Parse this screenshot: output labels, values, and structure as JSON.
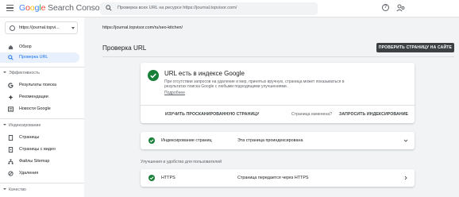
{
  "app": {
    "logo_google": [
      "G",
      "o",
      "o",
      "g",
      "l",
      "e"
    ],
    "logo_product": "Search Console"
  },
  "search": {
    "placeholder": "Проверка всех URL на ресурсе https://journal.topvisor.com/"
  },
  "property": {
    "label": "https://journal.topvi...",
    "icon": "globe-icon"
  },
  "sidebar": {
    "items_top": [
      {
        "label": "Обзор",
        "icon": "home-icon"
      },
      {
        "label": "Проверка URL",
        "icon": "search-icon",
        "active": true
      }
    ],
    "section_performance": "Эффективность",
    "items_performance": [
      {
        "label": "Результаты поиска",
        "icon": "google-g-icon"
      },
      {
        "label": "Рекомендации",
        "icon": "sparkle-icon"
      },
      {
        "label": "Новости Google",
        "icon": "news-icon"
      }
    ],
    "section_indexing": "Индексирование",
    "items_indexing": [
      {
        "label": "Страницы",
        "icon": "pages-icon"
      },
      {
        "label": "Страницы с видео",
        "icon": "video-pages-icon"
      },
      {
        "label": "Файлы Sitemap",
        "icon": "sitemap-icon"
      },
      {
        "label": "Удаления",
        "icon": "removals-icon"
      }
    ],
    "section_quality": "Качество"
  },
  "main": {
    "url": "https://journal.topvisor.com/ru/seo-kitchen/",
    "title": "Проверка URL",
    "live_test_button": "ПРОВЕРИТЬ СТРАНИЦУ НА САЙТЕ",
    "status_card": {
      "heading": "URL есть в индексе Google",
      "description": "При отсутствии запросов на удаление и мер, принятых вручную, страница может показываться в результатах поиска Google с любыми подходящими улучшениями.",
      "more_link": "Подробнее",
      "view_crawled": "ИЗУЧИТЬ ПРОСКАНИРОВАННУЮ СТРАНИЦУ",
      "page_changed": "Страница изменена?",
      "request_indexing": "ЗАПРОСИТЬ ИНДЕКСИРОВАНИЕ"
    },
    "indexing_row": {
      "label": "Индексирование страниц",
      "value": "Эта страница проиндексирована"
    },
    "enhancements_label": "Улучшения и удобство для пользователей",
    "https_row": {
      "label": "HTTPS",
      "value": "Страница передается через HTTPS"
    }
  },
  "colors": {
    "accent": "#1a73e8",
    "success": "#188038",
    "active_bg": "#e8f0fe"
  }
}
